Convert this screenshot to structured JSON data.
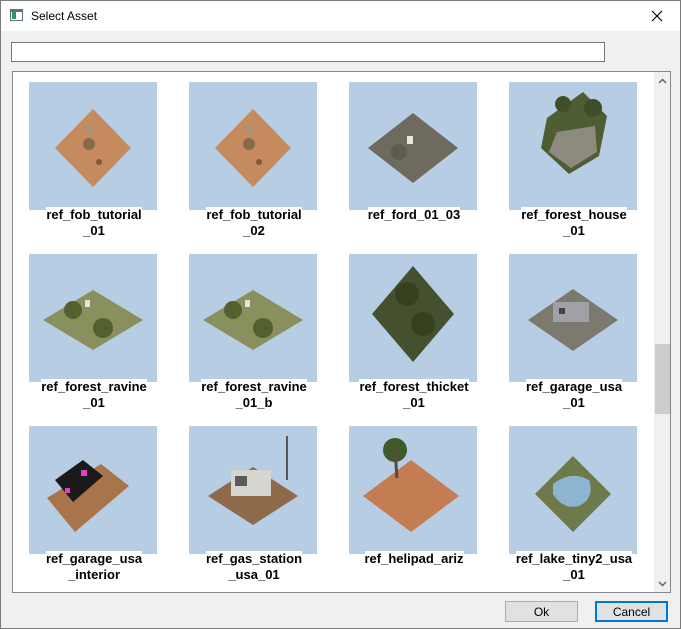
{
  "window": {
    "title": "Select Asset"
  },
  "search": {
    "value": "",
    "placeholder": ""
  },
  "assets": [
    {
      "label": "ref_fob_tutorial_01",
      "line1": "ref_fob_tutorial",
      "line2": "_01",
      "thumb": "sand-small"
    },
    {
      "label": "ref_fob_tutorial_02",
      "line1": "ref_fob_tutorial",
      "line2": "_02",
      "thumb": "sand-small"
    },
    {
      "label": "ref_ford_01_03",
      "line1": "ref_ford_01_03",
      "line2": "",
      "thumb": "gray-ford"
    },
    {
      "label": "ref_forest_house_01",
      "line1": "ref_forest_house",
      "line2": "_01",
      "thumb": "forest-house"
    },
    {
      "label": "ref_forest_ravine_01",
      "line1": "ref_forest_ravine",
      "line2": "_01",
      "thumb": "ravine"
    },
    {
      "label": "ref_forest_ravine_01_b",
      "line1": "ref_forest_ravine",
      "line2": "_01_b",
      "thumb": "ravine"
    },
    {
      "label": "ref_forest_thicket_01",
      "line1": "ref_forest_thicket",
      "line2": "_01",
      "thumb": "thicket"
    },
    {
      "label": "ref_garage_usa_01",
      "line1": "ref_garage_usa",
      "line2": "_01",
      "thumb": "garage"
    },
    {
      "label": "ref_garage_usa_interior",
      "line1": "ref_garage_usa",
      "line2": "_interior",
      "thumb": "garage-interior"
    },
    {
      "label": "ref_gas_station_usa_01",
      "line1": "ref_gas_station",
      "line2": "_usa_01",
      "thumb": "gas-station"
    },
    {
      "label": "ref_helipad_ariz",
      "line1": "ref_helipad_ariz",
      "line2": "",
      "thumb": "helipad"
    },
    {
      "label": "ref_lake_tiny2_usa_01",
      "line1": "ref_lake_tiny2_usa",
      "line2": "_01",
      "thumb": "lake"
    }
  ],
  "buttons": {
    "ok": "Ok",
    "cancel": "Cancel"
  },
  "colors": {
    "thumb_bg": "#b7cde4",
    "sand": "#c58a5e",
    "dirt": "#a8754a",
    "forest": "#5f6d3f",
    "gray": "#6f6a5e",
    "accent": "#0078d7"
  },
  "icons": {
    "app": "app-window-icon",
    "close": "close-icon",
    "scroll_up": "chevron-up-icon",
    "scroll_down": "chevron-down-icon"
  }
}
